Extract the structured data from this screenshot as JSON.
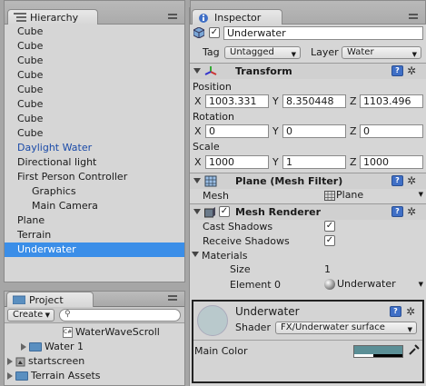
{
  "hierarchy": {
    "tab_label": "Hierarchy",
    "items": [
      {
        "label": "Cube",
        "style": "normal"
      },
      {
        "label": "Cube",
        "style": "normal"
      },
      {
        "label": "Cube",
        "style": "normal"
      },
      {
        "label": "Cube",
        "style": "normal"
      },
      {
        "label": "Cube",
        "style": "normal"
      },
      {
        "label": "Cube",
        "style": "normal"
      },
      {
        "label": "Cube",
        "style": "normal"
      },
      {
        "label": "Cube",
        "style": "normal"
      },
      {
        "label": "Daylight Water",
        "style": "blue"
      },
      {
        "label": "Directional light",
        "style": "normal"
      },
      {
        "label": "First Person Controller",
        "style": "normal"
      },
      {
        "label": "Graphics",
        "style": "child"
      },
      {
        "label": "Main Camera",
        "style": "child"
      },
      {
        "label": "Plane",
        "style": "normal"
      },
      {
        "label": "Terrain",
        "style": "normal"
      },
      {
        "label": "Underwater",
        "style": "selected"
      }
    ]
  },
  "project": {
    "tab_label": "Project",
    "create_label": "Create",
    "items": [
      {
        "label": "WaterWaveScroll",
        "kind": "script"
      },
      {
        "label": "Water 1",
        "kind": "folder"
      },
      {
        "label": "startscreen",
        "kind": "scene"
      },
      {
        "label": "Terrain Assets",
        "kind": "folder"
      }
    ]
  },
  "inspector": {
    "tab_label": "Inspector",
    "object_name": "Underwater",
    "tag_label": "Tag",
    "tag_value": "Untagged",
    "layer_label": "Layer",
    "layer_value": "Water",
    "transform": {
      "title": "Transform",
      "position_label": "Position",
      "position": {
        "x": "1003.331",
        "y": "8.350448",
        "z": "1103.496"
      },
      "rotation_label": "Rotation",
      "rotation": {
        "x": "0",
        "y": "0",
        "z": "0"
      },
      "scale_label": "Scale",
      "scale": {
        "x": "1000",
        "y": "1",
        "z": "1000"
      },
      "x_label": "X",
      "y_label": "Y",
      "z_label": "Z"
    },
    "mesh_filter": {
      "title": "Plane (Mesh Filter)",
      "mesh_label": "Mesh",
      "mesh_value": "Plane"
    },
    "mesh_renderer": {
      "title": "Mesh Renderer",
      "cast_shadows_label": "Cast Shadows",
      "receive_shadows_label": "Receive Shadows",
      "materials_label": "Materials",
      "size_label": "Size",
      "size_value": "1",
      "element0_label": "Element 0",
      "element0_value": "Underwater"
    },
    "material": {
      "name": "Underwater",
      "shader_label": "Shader",
      "shader_value": "FX/Underwater surface",
      "main_color_label": "Main Color",
      "main_color_hex": "#5b8f96"
    }
  },
  "colors": {
    "selection": "#3b8ee8",
    "link_blue": "#1a4aa8",
    "panel_bg": "#d6d6d6"
  }
}
